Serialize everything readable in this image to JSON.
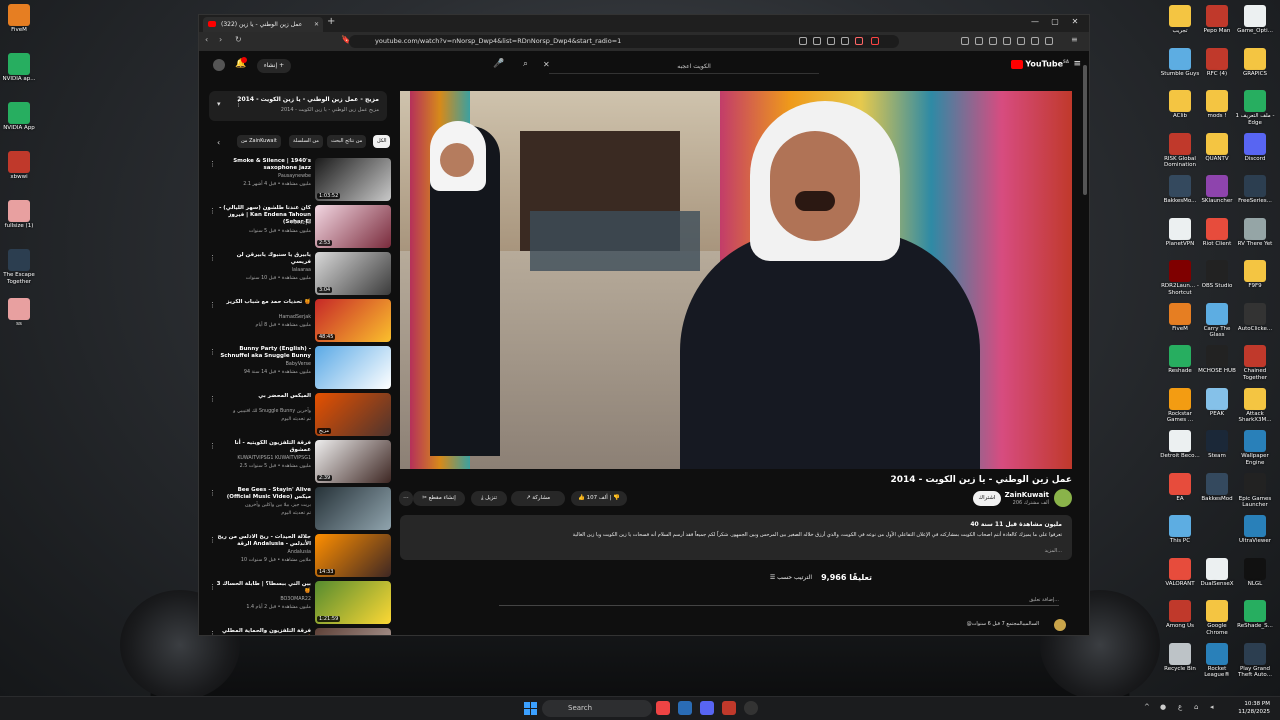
{
  "desktop": {
    "left_icons": [
      "FiveM",
      "NVIDIA ap...",
      "NVIDIA App",
      "xbwwi",
      "fullsize (1)",
      "The Escape Together",
      "ss"
    ],
    "right_icons": [
      {
        "label": "تجريب",
        "color": "#f4c542"
      },
      {
        "label": "Pepo Man",
        "color": "#c0392b"
      },
      {
        "label": "Game_Opti...",
        "color": "#ecf0f1"
      },
      {
        "label": "Stumble Guys",
        "color": "#5dade2"
      },
      {
        "label": "RFC (4)",
        "color": "#c0392b"
      },
      {
        "label": "GRAPICS",
        "color": "#f4c542"
      },
      {
        "label": "AClib",
        "color": "#f4c542"
      },
      {
        "label": "mods !",
        "color": "#f4c542"
      },
      {
        "label": "ملف التعريف 1 - Edge",
        "color": "#27ae60"
      },
      {
        "label": "RISK Global Domination",
        "color": "#c0392b"
      },
      {
        "label": "QUANTV",
        "color": "#f4c542"
      },
      {
        "label": "Discord",
        "color": "#5865f2"
      },
      {
        "label": "BakkesMo...",
        "color": "#34495e"
      },
      {
        "label": "SKlauncher",
        "color": "#8e44ad"
      },
      {
        "label": "FreeSeries...",
        "color": "#2c3e50"
      },
      {
        "label": "PlanetVPN",
        "color": "#ecf0f1"
      },
      {
        "label": "Riot Client",
        "color": "#e74c3c"
      },
      {
        "label": "RV There Yet",
        "color": "#95a5a6"
      },
      {
        "label": "RDR2Laun... - Shortcut",
        "color": "#7f0000"
      },
      {
        "label": "OBS Studio",
        "color": "#222"
      },
      {
        "label": "F9F9",
        "color": "#f4c542"
      },
      {
        "label": "FiveM",
        "color": "#e67e22"
      },
      {
        "label": "Carry The Glass",
        "color": "#5dade2"
      },
      {
        "label": "AutoClicke...",
        "color": "#333"
      },
      {
        "label": "Reshade",
        "color": "#27ae60"
      },
      {
        "label": "MCHOSE HUB",
        "color": "#222"
      },
      {
        "label": "Chained Together",
        "color": "#c0392b"
      },
      {
        "label": "Rockstar Games ...",
        "color": "#f39c12"
      },
      {
        "label": "PEAK",
        "color": "#85c1e9"
      },
      {
        "label": "Attack SharkX3M...",
        "color": "#f4c542"
      },
      {
        "label": "Detroit Beco...",
        "color": "#ecf0f1"
      },
      {
        "label": "Steam",
        "color": "#1b2838"
      },
      {
        "label": "Wallpaper Engine",
        "color": "#2980b9"
      },
      {
        "label": "EA",
        "color": "#e74c3c"
      },
      {
        "label": "BakkesMod",
        "color": "#34495e"
      },
      {
        "label": "Epic Games Launcher",
        "color": "#222"
      },
      {
        "label": "This PC",
        "color": "#5dade2"
      },
      {
        "label": "",
        "color": "transparent"
      },
      {
        "label": "UltraViewer",
        "color": "#2980b9"
      },
      {
        "label": "VALORANT",
        "color": "#e74c3c"
      },
      {
        "label": "DualSenseX",
        "color": "#ecf0f1"
      },
      {
        "label": "NLGL",
        "color": "#111"
      },
      {
        "label": "Among Us",
        "color": "#c0392b"
      },
      {
        "label": "Google Chrome",
        "color": "#f4c542"
      },
      {
        "label": "ReShade_S...",
        "color": "#27ae60"
      },
      {
        "label": "Recycle Bin",
        "color": "#bdc3c7"
      },
      {
        "label": "Rocket League®",
        "color": "#2980b9"
      },
      {
        "label": "Play Grand Theft Auto...",
        "color": "#2c3e50"
      }
    ]
  },
  "browser": {
    "tab_title": "(322) عمل زين الوطني - يا زين",
    "url": "youtube.com/watch?v=nNorsp_Dwp4&list=RDnNorsp_Dwp4&start_radio=1"
  },
  "yt": {
    "logo": "YouTube",
    "logo_region": "SA",
    "search_query": "الكويت اعجبه",
    "create_label": "إنشاء",
    "video_title": "عمل زين الوطني - يا زين الكويت - 2014",
    "channel": "ZainKuwait",
    "subs": "206 ألف مشترك",
    "subscribe": "اشتراك",
    "like_count": "107 ألف",
    "share": "مشاركة",
    "download": "تنزيل",
    "clip": "إنشاء مقطع",
    "views": "40 مليون مشاهدة  قبل 11 سنة",
    "desc": "تعرفوا على ما يميزك كالعادة أنتم اصحاب الكويت بمشاركته في الإعلان التفاعلي الأول من نوعه في الكويت، والذي أرزق خلاله الصغير بين المرحس وبين الجمهور. شكراً لكم جميعاً فقد أرسم السلام أنه فسحات يا زين الكويت ويا زين الغالية",
    "desc_more": "المزيد...",
    "comments_count": "9,966 تعليقًا",
    "sort": "الترتيب حسب",
    "add_comment": "إضافة تعليق...",
    "comment_preview": "@السالميبالمجتمع 7 قبل 6 سنوات",
    "playlist_title": "مزيج - عمل زين الوطني - يا زين الكويت - 2014",
    "playlist_sub": "مزيج عمل زين الوطني - يا زين الكويت - 2014",
    "chips": [
      "الكل",
      "من نتائج البحث",
      "من السلسلة",
      "من ZainKuwait"
    ],
    "recs": [
      {
        "title": "Smoke & Silence | 1940's saxophone jazz",
        "channel": "Pausaynewbe",
        "meta": "2.1 مليون مشاهدة • قبل 4 أشهر",
        "dur": "1:03:52",
        "c1": "#1a1a1a",
        "c2": "#c9c9c9"
      },
      {
        "title": "كان عندنا طلشون (سهر الليالي) - فيروز | Kan Endena Tahoun (Sahar El",
        "channel": "Fairuzye",
        "meta": "مليون مشاهدة • قبل 5 سنوات",
        "dur": "2:53",
        "c1": "#f2d7e2",
        "c2": "#7a2b3c"
      },
      {
        "title": "يابيرق يا سنبوك يابيرقن لن فريسي",
        "channel": "lalaaraa",
        "meta": "مليون مشاهدة • قبل 10 سنوات",
        "dur": "3:04",
        "c1": "#d9d9d9",
        "c2": "#3b3b3b"
      },
      {
        "title": "تحديات حمد مع شباب الكريز 🍯",
        "channel": "HamadSerjak",
        "meta": "مليون مشاهدة • قبل 8 أيام",
        "dur": "48:45",
        "c1": "#c62828",
        "c2": "#fbc02d"
      },
      {
        "title": "Bunny Party (English) - Schnuffel aka Snuggle Bunny",
        "channel": "BabyVerse",
        "meta": "94 مليون مشاهدة • قبل 14 سنة",
        "dur": "",
        "c1": "#5aa9e6",
        "c2": "#ffffff"
      },
      {
        "title": "الميكس المحضر بي",
        "channel": "لك اقتيبيي و Snuggle Bunny وآخرين",
        "meta": "تم تحديثه اليوم",
        "dur": "مزيج",
        "c1": "#e65100",
        "c2": "#4e342e"
      },
      {
        "title": "فرقة التلفزيون الكويتيه - أنا عمشوق",
        "channel": "KUWAITVIPSG1 KUWAITVIPSG1",
        "meta": "2.5 مليون مشاهدة • قبل 5 سنوات",
        "dur": "2:39",
        "c1": "#eeeeee",
        "c2": "#3e2723"
      },
      {
        "title": "Bee Gees - Stayin' Alive (Official Music Video) ميكس",
        "channel": "بريت جيز، بيلا بين واكلين وآخرون",
        "meta": "تم تحديثه اليوم",
        "dur": "",
        "c1": "#263238",
        "c2": "#90a4ae"
      },
      {
        "title": "جلالة الحيدات - ريح الادلس من ريح الرقة Andalusia - الأندلس",
        "channel": "Andalusia",
        "meta": "10 ملايين مشاهدة • قبل 9 سنوات",
        "dur": "14:33",
        "c1": "#ff8f00",
        "c2": "#3e2723"
      },
      {
        "title": "بين الني ببسطا؟ | طابلة الحساك 3 🍯",
        "channel": "BO3OMAR22",
        "meta": "1.4 مليون مشاهدة • قبل 2 أيام",
        "dur": "1:21:59",
        "c1": "#558b2f",
        "c2": "#fdd835"
      },
      {
        "title": "فرقة التلفزيون والحماية المطلي 🍯",
        "channel": "",
        "meta": "",
        "dur": "",
        "c1": "#5d4037",
        "c2": "#bcaaa4"
      }
    ]
  },
  "taskbar": {
    "search_label": "Search",
    "time": "10:38 PM",
    "date": "11/28/2025"
  }
}
